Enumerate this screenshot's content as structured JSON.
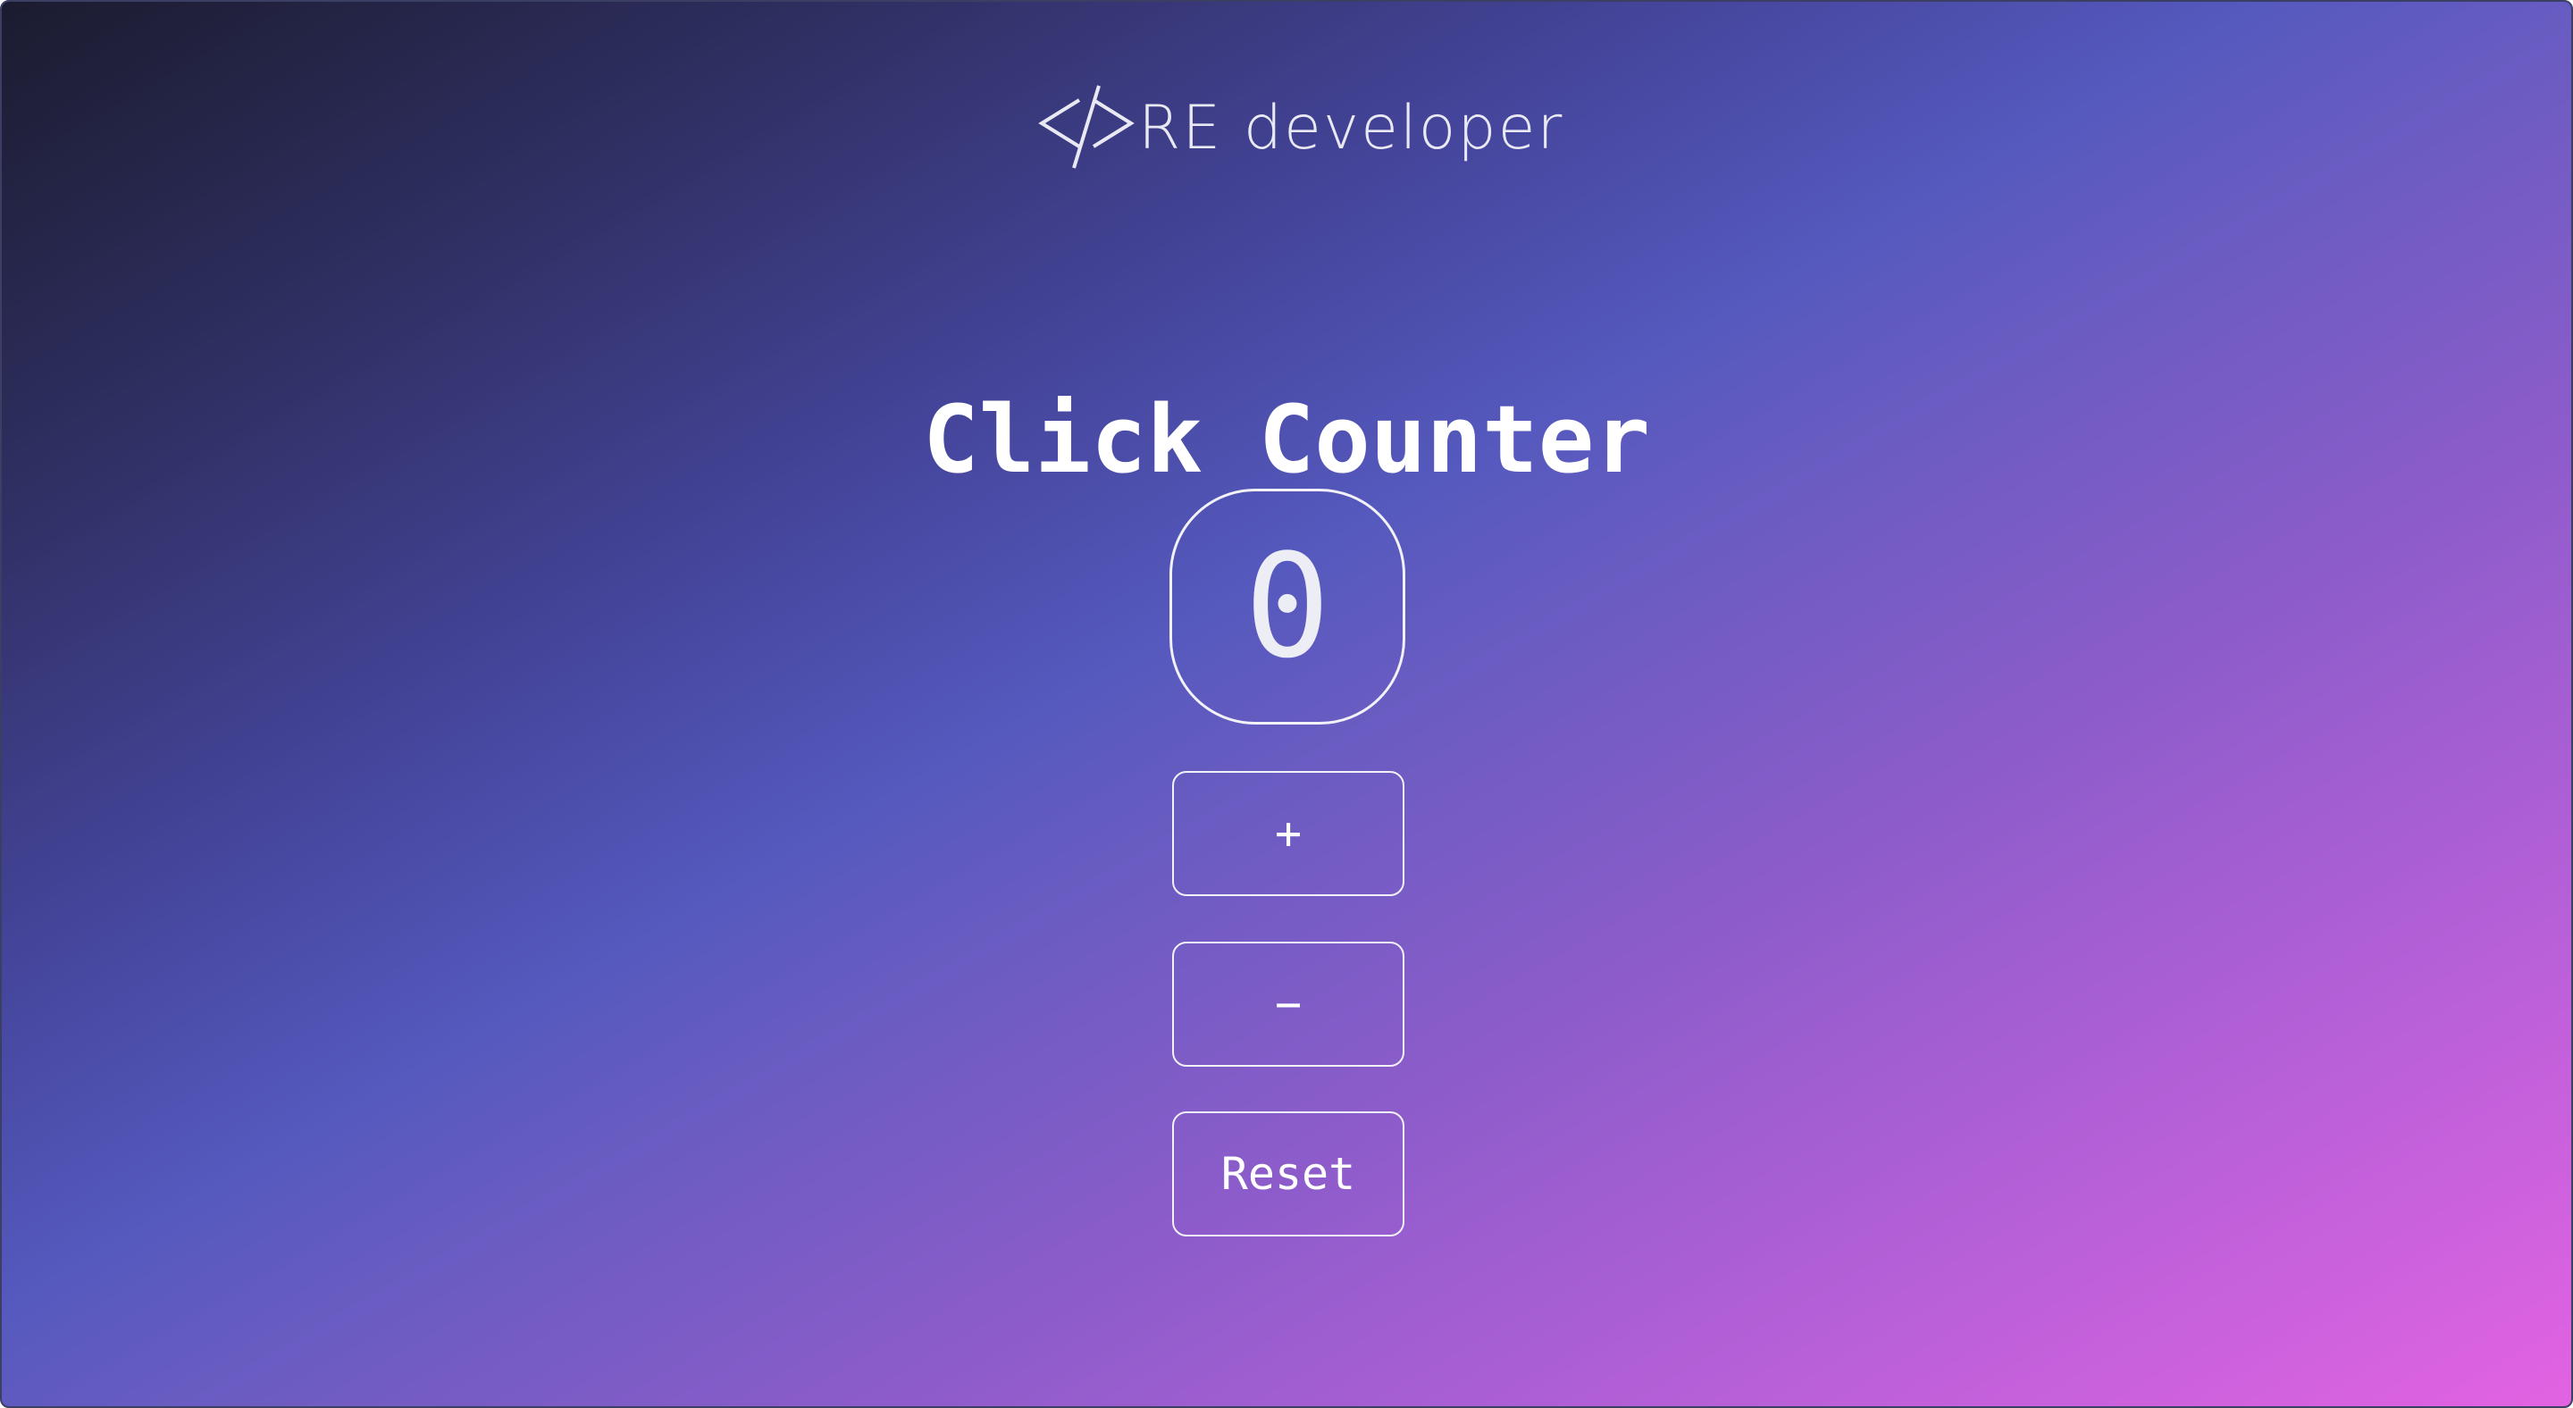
{
  "logo": {
    "text": "RE developer",
    "icon": "code-brackets-icon"
  },
  "title": "Click Counter",
  "counter": {
    "value": "0"
  },
  "buttons": {
    "increment_label": "+",
    "decrement_label": "−",
    "reset_label": "Reset"
  },
  "colors": {
    "gradient_start": "#1b1b2f",
    "gradient_mid": "#5559bd",
    "gradient_end": "#e263e2",
    "text": "#ffffff"
  }
}
